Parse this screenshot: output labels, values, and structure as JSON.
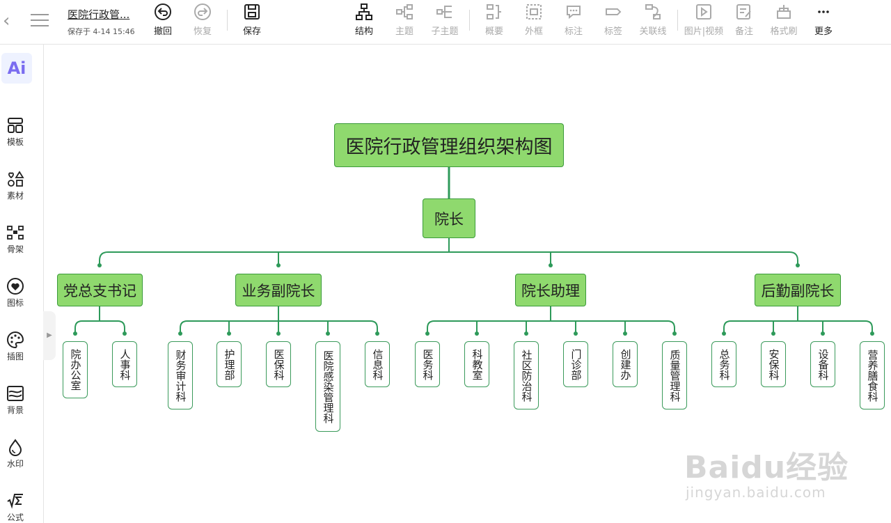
{
  "header": {
    "title": "医院行政管...",
    "saved": "保存于 4-14 15:46"
  },
  "toolbar": {
    "undo": "撤回",
    "redo": "恢复",
    "save": "保存",
    "structure": "结构",
    "topic": "主题",
    "subtopic": "子主题",
    "summary": "概要",
    "boundary": "外框",
    "callout": "标注",
    "tag": "标签",
    "relation": "关联线",
    "media": "图片|视频",
    "note": "备注",
    "format_painter": "格式刷",
    "more": "更多"
  },
  "sidebar": {
    "ai": "Ai",
    "items": [
      "模板",
      "素材",
      "骨架",
      "图标",
      "插图",
      "背景",
      "水印",
      "公式"
    ]
  },
  "mindmap": {
    "root": "医院行政管理组织架构图",
    "director": "院长",
    "branches": [
      {
        "label": "党总支书记",
        "children": [
          "院办公室",
          "人事科"
        ]
      },
      {
        "label": "业务副院长",
        "children": [
          "财务审计科",
          "护理部",
          "医保科",
          "医院感染管理科",
          "信息科"
        ]
      },
      {
        "label": "院长助理",
        "children": [
          "医务科",
          "科教室",
          "社区防治科",
          "门诊部",
          "创建办",
          "质量管理科"
        ]
      },
      {
        "label": "后勤副院长",
        "children": [
          "总务科",
          "安保科",
          "设备科",
          "营养膳食科"
        ]
      }
    ]
  },
  "watermark": {
    "brand": "Baidu经验",
    "url": "jingyan.baidu.com"
  },
  "colors": {
    "node_fill": "#8fd96e",
    "node_border": "#3a9a3a",
    "line": "#2e9a5a"
  }
}
